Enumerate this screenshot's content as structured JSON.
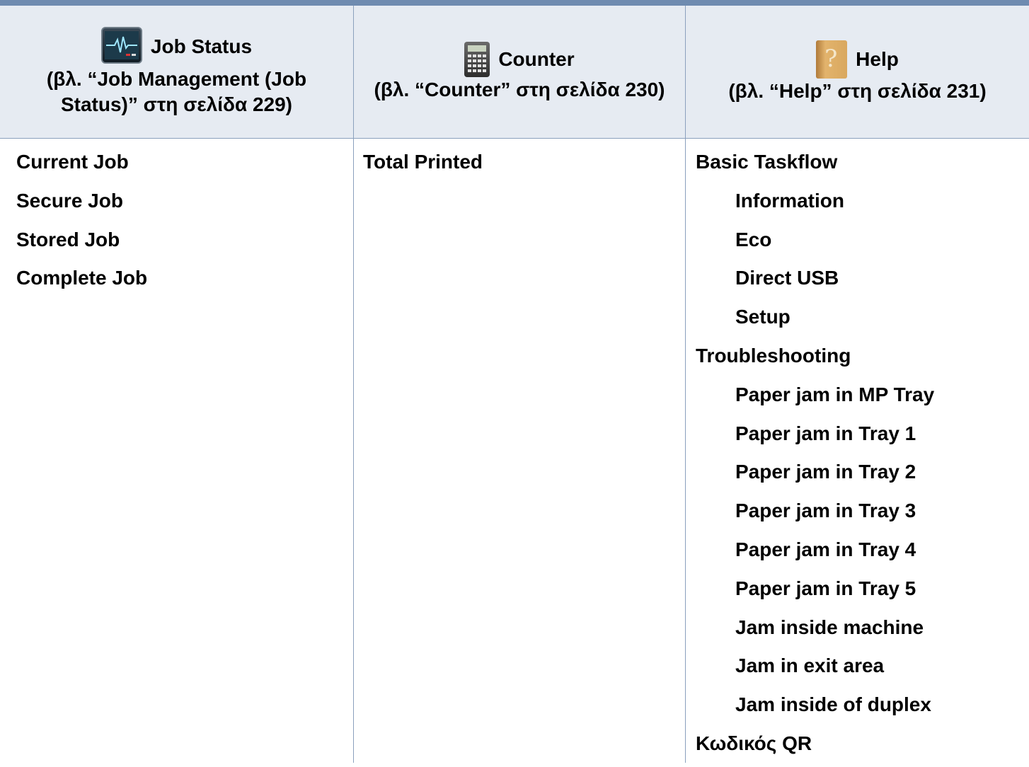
{
  "columns": [
    {
      "title": "Job Status",
      "reference": "(βλ. “Job Management (Job Status)” στη σελίδα 229)",
      "reference_lines": [
        "(βλ. “Job Management (Job",
        "Status)” στη σελίδα 229)"
      ],
      "icon": "job-status-monitor-icon",
      "items": [
        {
          "label": "Current Job",
          "level": 0
        },
        {
          "label": "Secure Job",
          "level": 0
        },
        {
          "label": "Stored Job",
          "level": 0
        },
        {
          "label": "Complete Job",
          "level": 0
        }
      ]
    },
    {
      "title": "Counter",
      "reference": "(βλ. “Counter” στη σελίδα 230)",
      "icon": "calculator-icon",
      "items": [
        {
          "label": "Total Printed",
          "level": 0
        }
      ]
    },
    {
      "title": "Help",
      "reference": "(βλ. “Help” στη σελίδα 231)",
      "icon": "help-book-icon",
      "items": [
        {
          "label": "Basic Taskflow",
          "level": 0
        },
        {
          "label": "Information",
          "level": 1
        },
        {
          "label": "Eco",
          "level": 1
        },
        {
          "label": "Direct USB",
          "level": 1
        },
        {
          "label": "Setup",
          "level": 1
        },
        {
          "label": "Troubleshooting",
          "level": 0
        },
        {
          "label": "Paper jam in MP Tray",
          "level": 1
        },
        {
          "label": "Paper jam in Tray 1",
          "level": 1
        },
        {
          "label": "Paper jam in Tray 2",
          "level": 1
        },
        {
          "label": "Paper jam in Tray 3",
          "level": 1
        },
        {
          "label": "Paper jam in Tray 4",
          "level": 1
        },
        {
          "label": "Paper jam in Tray 5",
          "level": 1
        },
        {
          "label": "Jam inside machine",
          "level": 1
        },
        {
          "label": "Jam in exit area",
          "level": 1
        },
        {
          "label": "Jam inside of duplex",
          "level": 1
        },
        {
          "label": "Κωδικός QR",
          "level": 0
        }
      ]
    }
  ],
  "colors": {
    "header_bg": "#e6ebf2",
    "rule": "#6f8bb0",
    "divider": "#8aa0bd"
  }
}
